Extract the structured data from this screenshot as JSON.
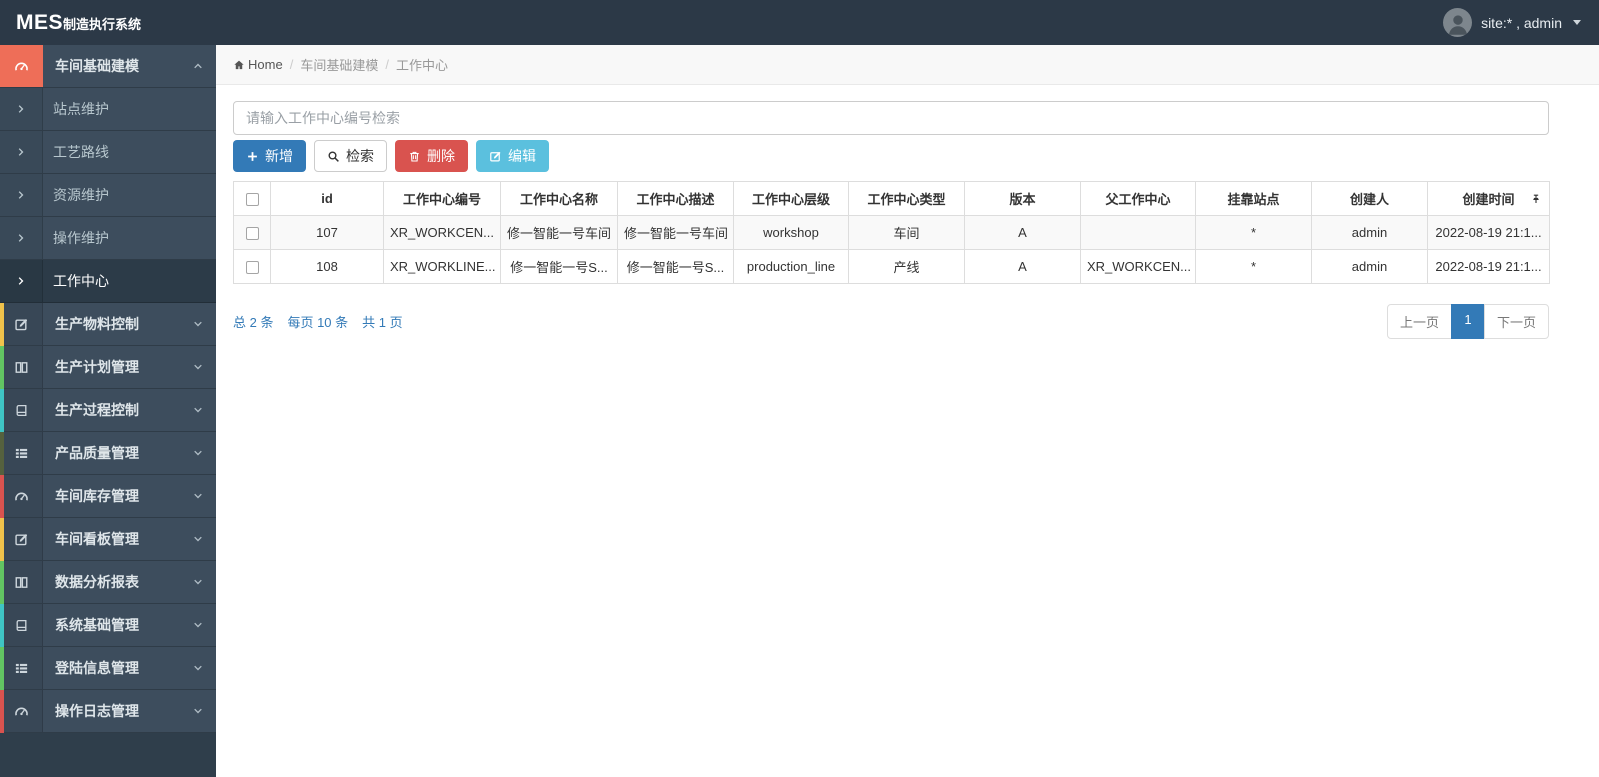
{
  "navbar": {
    "logo_bold": "MES",
    "logo_text": "制造执行系统",
    "user_label": "site:* , admin"
  },
  "sidebar": {
    "groups": [
      {
        "label": "车间基础建模",
        "icon": "gauge-icon",
        "icon_bg": "#ee6e58",
        "expanded": true,
        "children": [
          "站点维护",
          "工艺路线",
          "资源维护",
          "操作维护",
          "工作中心"
        ],
        "active_child": "工作中心"
      },
      {
        "label": "生产物料控制",
        "icon": "edit-icon",
        "strip": "#f0c24b"
      },
      {
        "label": "生产计划管理",
        "icon": "columns-icon",
        "strip": "#62c462"
      },
      {
        "label": "生产过程控制",
        "icon": "book-icon",
        "strip": "#3fc4c4"
      },
      {
        "label": "产品质量管理",
        "icon": "list-icon",
        "strip": "#55613e"
      },
      {
        "label": "车间库存管理",
        "icon": "gauge-icon",
        "strip": "#d9534f"
      },
      {
        "label": "车间看板管理",
        "icon": "edit-icon",
        "strip": "#f0c24b"
      },
      {
        "label": "数据分析报表",
        "icon": "columns-icon",
        "strip": "#62c462"
      },
      {
        "label": "系统基础管理",
        "icon": "book-icon",
        "strip": "#3fc4c4"
      },
      {
        "label": "登陆信息管理",
        "icon": "list-icon",
        "strip": "#62c462"
      },
      {
        "label": "操作日志管理",
        "icon": "gauge-icon",
        "strip": "#d9534f"
      }
    ]
  },
  "breadcrumb": {
    "home": "Home",
    "items": [
      "车间基础建模",
      "工作中心"
    ]
  },
  "search": {
    "placeholder": "请输入工作中心编号检索"
  },
  "toolbar": {
    "add_label": "新增",
    "add_bg": "#337ab7",
    "search_label": "检索",
    "delete_label": "删除",
    "delete_bg": "#d9534f",
    "edit_label": "编辑",
    "edit_bg": "#5bc0de"
  },
  "table": {
    "columns": [
      "id",
      "工作中心编号",
      "工作中心名称",
      "工作中心描述",
      "工作中心层级",
      "工作中心类型",
      "版本",
      "父工作中心",
      "挂靠站点",
      "创建人",
      "创建时间"
    ],
    "rows": [
      [
        "107",
        "XR_WORKCEN...",
        "修一智能一号车间",
        "修一智能一号车间",
        "workshop",
        "车间",
        "A",
        "",
        "*",
        "admin",
        "2022-08-19 21:1..."
      ],
      [
        "108",
        "XR_WORKLINE...",
        "修一智能一号S...",
        "修一智能一号S...",
        "production_line",
        "产线",
        "A",
        "XR_WORKCEN...",
        "*",
        "admin",
        "2022-08-19 21:1..."
      ]
    ]
  },
  "pagination": {
    "summary_total": "总 2 条",
    "summary_per_page": "每页 10 条",
    "summary_pages": "共 1 页",
    "prev": "上一页",
    "current": "1",
    "next": "下一页"
  }
}
